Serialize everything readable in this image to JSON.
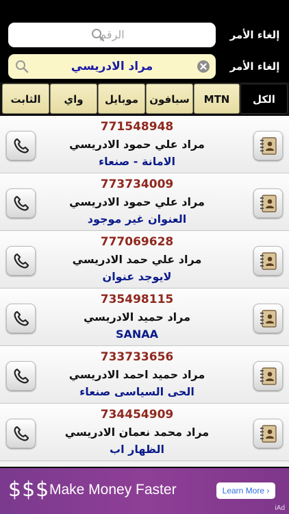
{
  "search_number": {
    "placeholder": "الرقم",
    "cancel_label": "إلغاء الأمر"
  },
  "search_name": {
    "value": "مراد الادريسي",
    "cancel_label": "إلغاء الأمر"
  },
  "tabs": [
    {
      "label": "الكل",
      "active": true
    },
    {
      "label": "MTN",
      "active": false
    },
    {
      "label": "سبافون",
      "active": false
    },
    {
      "label": "موبايل",
      "active": false
    },
    {
      "label": "واي",
      "active": false
    },
    {
      "label": "الثابت",
      "active": false
    }
  ],
  "contacts": [
    {
      "number": "771548948",
      "name": "مراد علي حمود الادريسي",
      "address": "الامانة - صنعاء"
    },
    {
      "number": "773734009",
      "name": "مراد علي حمود الادريسي",
      "address": "العنوان غير موجود"
    },
    {
      "number": "777069628",
      "name": "مراد علي حمد الادريسي",
      "address": "لايوجد عنوان"
    },
    {
      "number": "735498115",
      "name": "مراد حميد الادريسي",
      "address": "SANAA"
    },
    {
      "number": "733733656",
      "name": "مراد حميد احمد الادريسي",
      "address": "الحى السياسى صنعاء"
    },
    {
      "number": "734454909",
      "name": "مراد محمد نعمان الادريسي",
      "address": "الظهار اب"
    }
  ],
  "ad": {
    "dollars": "$$$",
    "headline": "Make Money Faster",
    "button_label": "Learn More ›",
    "network_label": "iAd"
  },
  "colors": {
    "number_text": "#8f281e",
    "address_text": "#0c1b8a",
    "search_value_text": "#1a1aa8",
    "ad_background": "#8e3f96"
  },
  "icons": [
    "search-icon",
    "clear-icon",
    "phone-icon",
    "address-book-icon"
  ]
}
